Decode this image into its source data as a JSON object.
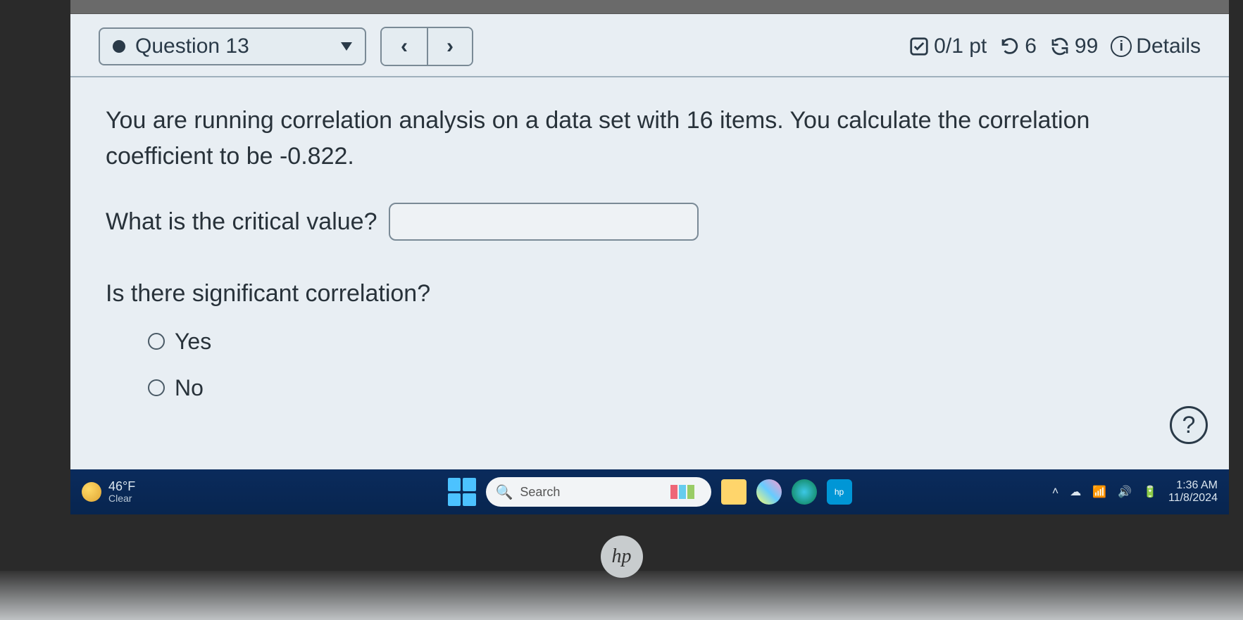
{
  "header": {
    "question_label": "Question 13",
    "prev_symbol": "‹",
    "next_symbol": "›",
    "score_text": "0/1 pt",
    "attempts_left": "6",
    "retries": "99",
    "details_label": "Details"
  },
  "question": {
    "prompt": "You are running correlation analysis on a data set with 16 items. You calculate the correlation coefficient to be -0.822.",
    "critical_value_label": "What is the critical value?",
    "critical_value_input": "",
    "sig_label": "Is there significant correlation?",
    "options": {
      "yes": "Yes",
      "no": "No"
    }
  },
  "help": {
    "symbol": "?"
  },
  "taskbar": {
    "weather": {
      "temp": "46°F",
      "cond": "Clear"
    },
    "search_placeholder": "Search",
    "time": "1:36 AM",
    "date": "11/8/2024"
  },
  "logo": {
    "text": "hp"
  }
}
